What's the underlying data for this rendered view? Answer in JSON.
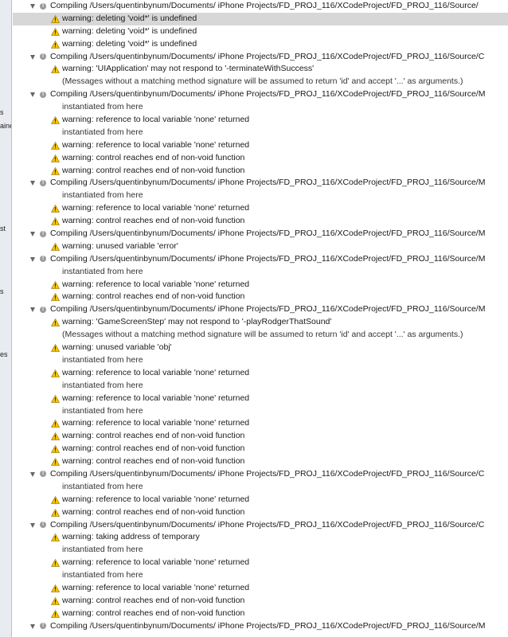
{
  "sidebar": {
    "fragments": [
      {
        "text": "s"
      },
      {
        "text": "aine"
      },
      {
        "text": "st"
      },
      {
        "text": "s"
      },
      {
        "text": "es"
      }
    ]
  },
  "log": {
    "selected_index": 1,
    "rows": [
      {
        "type": "compile",
        "text": "Compiling /Users/quentinbynum/Documents/ iPhone Projects/FD_PROJ_116/XCodeProject/FD_PROJ_116/Source/"
      },
      {
        "type": "warning",
        "text": "warning: deleting 'void*' is undefined"
      },
      {
        "type": "warning",
        "text": "warning: deleting 'void*' is undefined"
      },
      {
        "type": "warning",
        "text": "warning: deleting 'void*' is undefined"
      },
      {
        "type": "compile",
        "text": "Compiling /Users/quentinbynum/Documents/ iPhone Projects/FD_PROJ_116/XCodeProject/FD_PROJ_116/Source/C"
      },
      {
        "type": "warning",
        "text": "warning: 'UIApplication' may not respond to '-terminateWithSuccess'"
      },
      {
        "type": "note",
        "text": "(Messages without a matching method signature will be assumed to return 'id' and accept '...' as arguments.)"
      },
      {
        "type": "compile",
        "text": "Compiling /Users/quentinbynum/Documents/ iPhone Projects/FD_PROJ_116/XCodeProject/FD_PROJ_116/Source/M"
      },
      {
        "type": "note",
        "text": "instantiated from here"
      },
      {
        "type": "warning",
        "text": "warning: reference to local variable 'none' returned"
      },
      {
        "type": "note",
        "text": "instantiated from here"
      },
      {
        "type": "warning",
        "text": "warning: reference to local variable 'none' returned"
      },
      {
        "type": "warning",
        "text": "warning: control reaches end of non-void function"
      },
      {
        "type": "warning",
        "text": "warning: control reaches end of non-void function"
      },
      {
        "type": "compile",
        "text": "Compiling /Users/quentinbynum/Documents/ iPhone Projects/FD_PROJ_116/XCodeProject/FD_PROJ_116/Source/M"
      },
      {
        "type": "note",
        "text": "instantiated from here"
      },
      {
        "type": "warning",
        "text": "warning: reference to local variable 'none' returned"
      },
      {
        "type": "warning",
        "text": "warning: control reaches end of non-void function"
      },
      {
        "type": "compile",
        "text": "Compiling /Users/quentinbynum/Documents/ iPhone Projects/FD_PROJ_116/XCodeProject/FD_PROJ_116/Source/M"
      },
      {
        "type": "warning",
        "text": "warning: unused variable 'error'"
      },
      {
        "type": "compile",
        "text": "Compiling /Users/quentinbynum/Documents/ iPhone Projects/FD_PROJ_116/XCodeProject/FD_PROJ_116/Source/M"
      },
      {
        "type": "note",
        "text": "instantiated from here"
      },
      {
        "type": "warning",
        "text": "warning: reference to local variable 'none' returned"
      },
      {
        "type": "warning",
        "text": "warning: control reaches end of non-void function"
      },
      {
        "type": "compile",
        "text": "Compiling /Users/quentinbynum/Documents/ iPhone Projects/FD_PROJ_116/XCodeProject/FD_PROJ_116/Source/M"
      },
      {
        "type": "warning",
        "text": "warning: 'GameScreenStep' may not respond to '-playRodgerThatSound'"
      },
      {
        "type": "note",
        "text": "(Messages without a matching method signature will be assumed to return 'id' and accept '...' as arguments.)"
      },
      {
        "type": "warning",
        "text": "warning: unused variable 'obj'"
      },
      {
        "type": "note",
        "text": "instantiated from here"
      },
      {
        "type": "warning",
        "text": "warning: reference to local variable 'none' returned"
      },
      {
        "type": "note",
        "text": "instantiated from here"
      },
      {
        "type": "warning",
        "text": "warning: reference to local variable 'none' returned"
      },
      {
        "type": "note",
        "text": "instantiated from here"
      },
      {
        "type": "warning",
        "text": "warning: reference to local variable 'none' returned"
      },
      {
        "type": "warning",
        "text": "warning: control reaches end of non-void function"
      },
      {
        "type": "warning",
        "text": "warning: control reaches end of non-void function"
      },
      {
        "type": "warning",
        "text": "warning: control reaches end of non-void function"
      },
      {
        "type": "compile",
        "text": "Compiling /Users/quentinbynum/Documents/ iPhone Projects/FD_PROJ_116/XCodeProject/FD_PROJ_116/Source/C"
      },
      {
        "type": "note",
        "text": "instantiated from here"
      },
      {
        "type": "warning",
        "text": "warning: reference to local variable 'none' returned"
      },
      {
        "type": "warning",
        "text": "warning: control reaches end of non-void function"
      },
      {
        "type": "compile",
        "text": "Compiling /Users/quentinbynum/Documents/ iPhone Projects/FD_PROJ_116/XCodeProject/FD_PROJ_116/Source/C"
      },
      {
        "type": "warning",
        "text": "warning: taking address of temporary"
      },
      {
        "type": "note",
        "text": "instantiated from here"
      },
      {
        "type": "warning",
        "text": "warning: reference to local variable 'none' returned"
      },
      {
        "type": "note",
        "text": "instantiated from here"
      },
      {
        "type": "warning",
        "text": "warning: reference to local variable 'none' returned"
      },
      {
        "type": "warning",
        "text": "warning: control reaches end of non-void function"
      },
      {
        "type": "warning",
        "text": "warning: control reaches end of non-void function"
      },
      {
        "type": "compile",
        "text": "Compiling /Users/quentinbynum/Documents/ iPhone Projects/FD_PROJ_116/XCodeProject/FD_PROJ_116/Source/M"
      }
    ]
  },
  "colors": {
    "warning_fill": "#f5c400",
    "warning_stroke": "#a07800",
    "selected_row": "#d7d7d7"
  },
  "icons": {
    "compile": [
      "disclosure-triangle-icon",
      "info-icon"
    ],
    "warning": "warning-icon"
  }
}
